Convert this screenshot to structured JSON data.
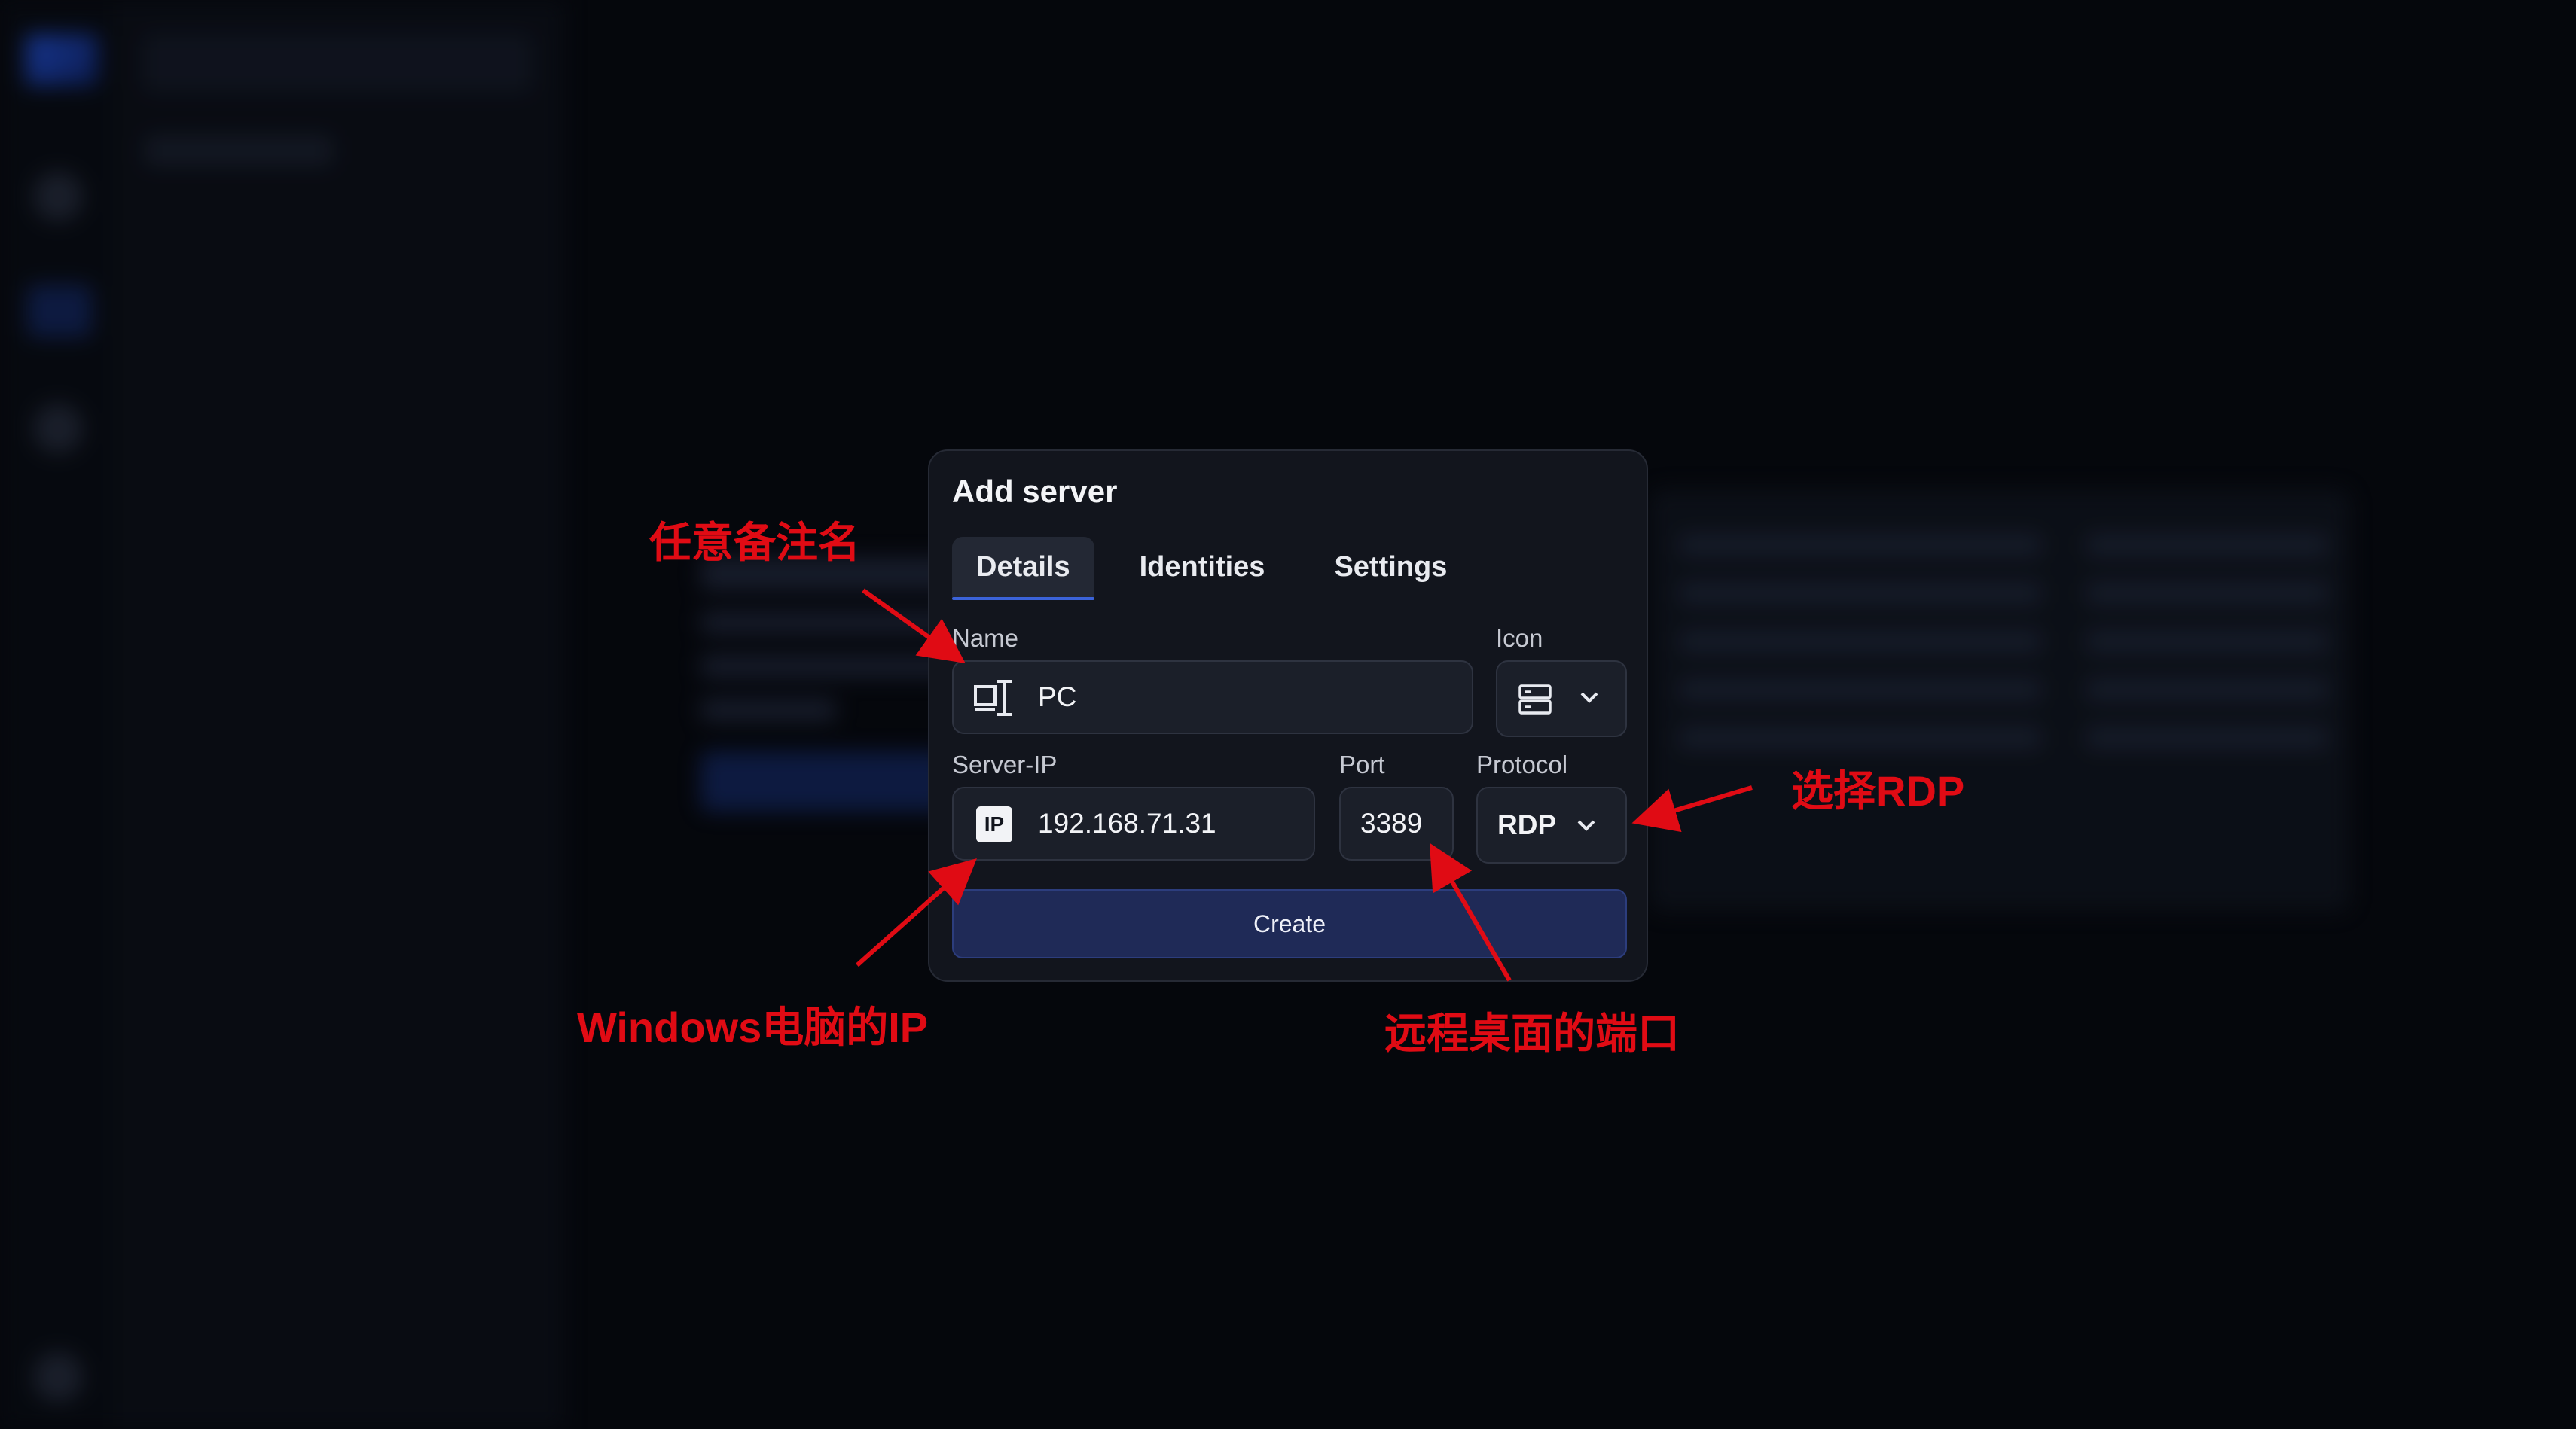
{
  "dialog": {
    "title": "Add server",
    "tabs": [
      {
        "label": "Details",
        "active": true
      },
      {
        "label": "Identities",
        "active": false
      },
      {
        "label": "Settings",
        "active": false
      }
    ],
    "name": {
      "label": "Name",
      "value": "PC",
      "icon": "desktop-pc-icon"
    },
    "icon_picker": {
      "label": "Icon",
      "selected_icon": "server-icon"
    },
    "server_ip": {
      "label": "Server-IP",
      "value": "192.168.71.31",
      "icon": "ip-icon",
      "icon_text": "IP"
    },
    "port": {
      "label": "Port",
      "value": "3389"
    },
    "protocol": {
      "label": "Protocol",
      "value": "RDP"
    },
    "create_label": "Create"
  },
  "annotations": {
    "name_note": "任意备注名",
    "protocol_note": "选择RDP",
    "ip_note": "Windows电脑的IP",
    "port_note": "远程桌面的端口"
  },
  "colors": {
    "background": "#05070c",
    "dialog": "#12151d",
    "field": "#1b1f29",
    "accent": "#3b63d9",
    "create_button": "#1f2a57",
    "annotation": "#e00b14"
  }
}
